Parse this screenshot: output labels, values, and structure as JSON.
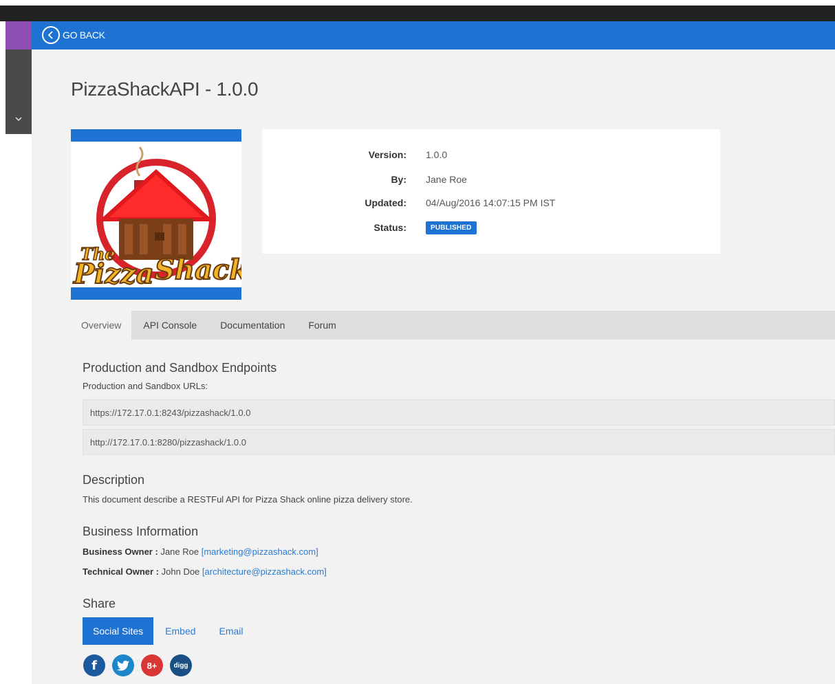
{
  "nav": {
    "go_back": "GO BACK"
  },
  "page": {
    "title": "PizzaShackAPI - 1.0.0"
  },
  "logo": {
    "alt": "The Pizza Shack",
    "word_the": "The",
    "word_pizza": "Pizza",
    "word_shack": "Shack"
  },
  "info": {
    "version_label": "Version:",
    "version": "1.0.0",
    "by_label": "By:",
    "by": "Jane Roe",
    "updated_label": "Updated:",
    "updated": "04/Aug/2016 14:07:15 PM IST",
    "status_label": "Status:",
    "status": "PUBLISHED"
  },
  "tabs": [
    {
      "label": "Overview",
      "active": true
    },
    {
      "label": "API Console",
      "active": false
    },
    {
      "label": "Documentation",
      "active": false
    },
    {
      "label": "Forum",
      "active": false
    }
  ],
  "endpoints": {
    "heading": "Production and Sandbox Endpoints",
    "subheading": "Production and Sandbox URLs:",
    "urls": [
      "https://172.17.0.1:8243/pizzashack/1.0.0",
      "http://172.17.0.1:8280/pizzashack/1.0.0"
    ]
  },
  "description": {
    "heading": "Description",
    "text": "This document describe a RESTFul API for Pizza Shack online pizza delivery store."
  },
  "business": {
    "heading": "Business Information",
    "owner_label": "Business Owner :",
    "owner_name": "Jane Roe",
    "owner_email": "marketing@pizzashack.com",
    "tech_label": "Technical Owner :",
    "tech_name": "John Doe",
    "tech_email": "architecture@pizzashack.com"
  },
  "share": {
    "heading": "Share",
    "tabs": [
      {
        "label": "Social Sites",
        "active": true
      },
      {
        "label": "Embed",
        "active": false
      },
      {
        "label": "Email",
        "active": false
      }
    ],
    "icons": [
      {
        "name": "facebook-icon",
        "glyph": "f",
        "color": "#1c5a9e"
      },
      {
        "name": "twitter-icon",
        "glyph": "",
        "color": "#1c86c8"
      },
      {
        "name": "google-plus-icon",
        "glyph": "8+",
        "color": "#d93636"
      },
      {
        "name": "digg-icon",
        "glyph": "digg",
        "color": "#1a4f84"
      }
    ]
  },
  "colors": {
    "brand_blue": "#1e73d2",
    "sidebar_purple": "#8d4fb5",
    "topbar": "#222222",
    "link": "#2a7bd4"
  }
}
